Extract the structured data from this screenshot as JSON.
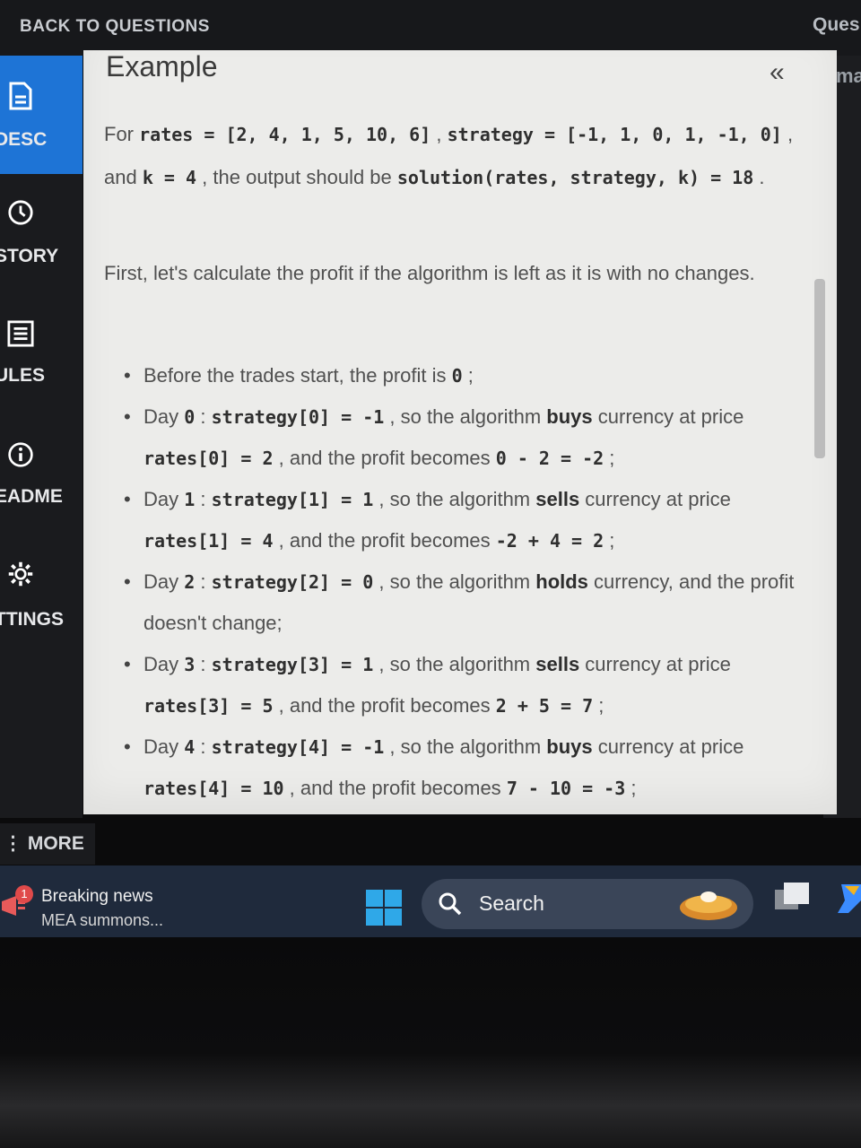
{
  "topbar": {
    "back_label": "BACK TO QUESTIONS",
    "right_label": "Ques"
  },
  "sidebar": {
    "items": [
      {
        "label": "DESC",
        "icon": "document-icon",
        "active": true
      },
      {
        "label": "STORY",
        "icon": "clock-icon",
        "active": false
      },
      {
        "label": "ULES",
        "icon": "list-icon",
        "active": false
      },
      {
        "label": "EADME",
        "icon": "info-icon",
        "active": false
      },
      {
        "label": "TTINGS",
        "icon": "gear-icon",
        "active": false
      }
    ],
    "more_label": "⋮ MORE"
  },
  "right_panel": {
    "label": "ma"
  },
  "content": {
    "section_title": "Example",
    "collapse_glyph": "«",
    "intro": {
      "t1": "For ",
      "c1": "rates = [2, 4, 1, 5, 10, 6]",
      "t2": " , ",
      "c2": "strategy = [-1, 1, 0, 1, -1, 0]",
      "t3": " , and ",
      "c3": "k = 4",
      "t4": " , the output should be ",
      "c4": "solution(rates, strategy, k) = 18",
      "t5": " ."
    },
    "paragraph": "First, let's calculate the profit if the algorithm is left as it is with no changes.",
    "steps": [
      {
        "p1": "Before the trades start, the profit is ",
        "c1": "0",
        "p2": " ;"
      },
      {
        "p1": "Day ",
        "c1": "0",
        "p2": " : ",
        "c2": "strategy[0] = -1",
        "p3": " , so the algorithm ",
        "b": "buys",
        "p4": " currency at price ",
        "c3": "rates[0] = 2",
        "p5": " , and the profit becomes ",
        "c4": "0 - 2 = -2",
        "p6": " ;"
      },
      {
        "p1": "Day ",
        "c1": "1",
        "p2": " : ",
        "c2": "strategy[1] = 1",
        "p3": " , so the algorithm ",
        "b": "sells",
        "p4": " currency at price ",
        "c3": "rates[1] = 4",
        "p5": " , and the profit becomes ",
        "c4": "-2 + 4 = 2",
        "p6": " ;"
      },
      {
        "p1": "Day ",
        "c1": "2",
        "p2": " : ",
        "c2": "strategy[2] = 0",
        "p3": " , so the algorithm ",
        "b": "holds",
        "p4": " currency, and the profit doesn't change;"
      },
      {
        "p1": "Day ",
        "c1": "3",
        "p2": " : ",
        "c2": "strategy[3] = 1",
        "p3": " , so the algorithm ",
        "b": "sells",
        "p4": " currency at price ",
        "c3": "rates[3] = 5",
        "p5": " , and the profit becomes ",
        "c4": "2 + 5 = 7",
        "p6": " ;"
      },
      {
        "p1": "Day ",
        "c1": "4",
        "p2": " : ",
        "c2": "strategy[4] = -1",
        "p3": " , so the algorithm ",
        "b": "buys",
        "p4": " currency at price ",
        "c3": "rates[4] = 10",
        "p5": " , and the profit becomes ",
        "c4": "7 - 10 = -3",
        "p6": " ;"
      }
    ]
  },
  "taskbar": {
    "news_badge": "1",
    "news_title": "Breaking news",
    "news_subtitle": "MEA summons...",
    "search_label": "Search"
  },
  "colors": {
    "accent": "#1e74d6",
    "panel_bg": "#ececea",
    "sidebar_bg": "#1a1b1e",
    "taskbar_bg": "#1f2a3c"
  }
}
